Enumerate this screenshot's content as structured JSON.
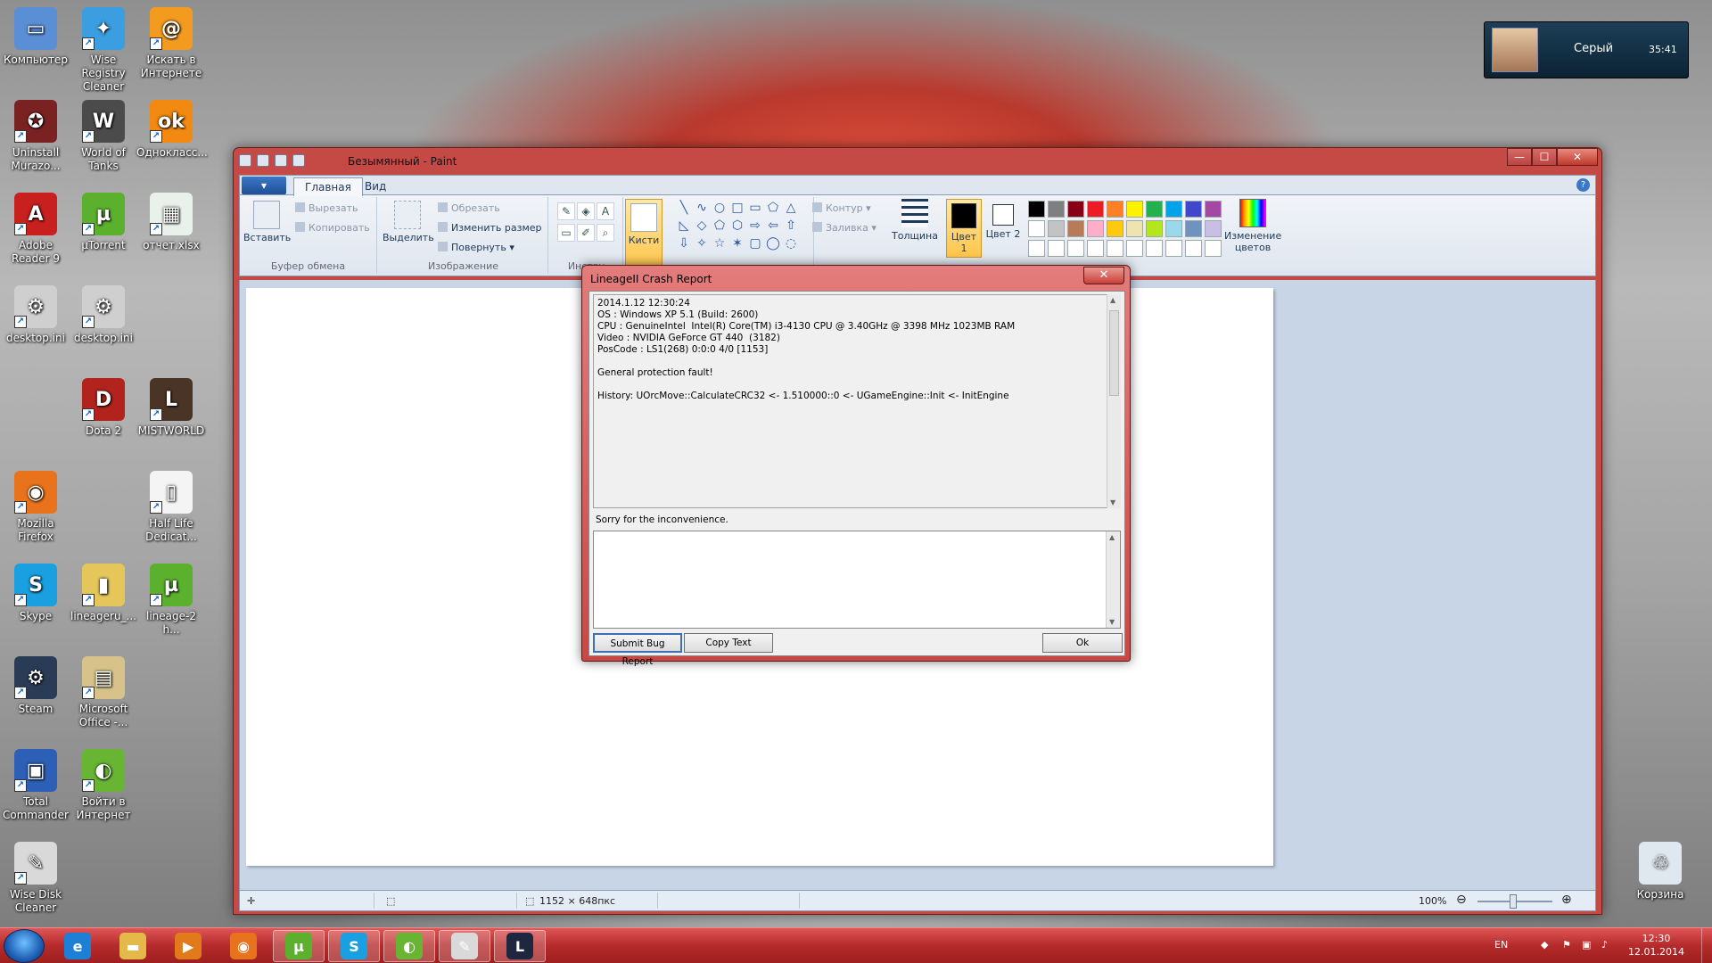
{
  "desktop_icons": [
    {
      "name": "computer",
      "label": "Компьютер",
      "color": "#5a8fd6",
      "glyph": "▭"
    },
    {
      "name": "wise-registry",
      "label": "Wise Registry Cleaner",
      "color": "#3a9ee0",
      "glyph": "✦"
    },
    {
      "name": "search-internet",
      "label": "Искать в Интернете",
      "color": "#f29b1f",
      "glyph": "@"
    },
    {
      "name": "uninstall",
      "label": "Uninstall Murazo...",
      "color": "#7a2222",
      "glyph": "✪"
    },
    {
      "name": "world-of-tanks",
      "label": "World of Tanks",
      "color": "#4b4b4b",
      "glyph": "W"
    },
    {
      "name": "odnoklassniki",
      "label": "Однокласс...",
      "color": "#f28a12",
      "glyph": "ok"
    },
    {
      "name": "adobe-reader",
      "label": "Adobe Reader 9",
      "color": "#c81f1f",
      "glyph": "A"
    },
    {
      "name": "utorrent",
      "label": "µTorrent",
      "color": "#5bb12d",
      "glyph": "µ"
    },
    {
      "name": "otchet",
      "label": "отчет.xlsx",
      "color": "#e9f1ea",
      "glyph": "▦"
    },
    {
      "name": "desktop-ini-1",
      "label": "desktop.ini",
      "color": "#cfcfcf",
      "glyph": "⚙"
    },
    {
      "name": "desktop-ini-2",
      "label": "desktop.ini",
      "color": "#cfcfcf",
      "glyph": "⚙"
    },
    {
      "name": "dota2",
      "label": "Dota 2",
      "color": "#b3231e",
      "glyph": "D"
    },
    {
      "name": "mistworld",
      "label": "MISTWORLD",
      "color": "#4a3426",
      "glyph": "L"
    },
    {
      "name": "firefox",
      "label": "Mozilla Firefox",
      "color": "#e8731c",
      "glyph": "◉"
    },
    {
      "name": "half-life",
      "label": "Half Life Dedicat...",
      "color": "#f4f4f4",
      "glyph": "▯"
    },
    {
      "name": "skype",
      "label": "Skype",
      "color": "#1a9fe0",
      "glyph": "S"
    },
    {
      "name": "lineageru",
      "label": "lineageru_...",
      "color": "#e5c65a",
      "glyph": "▮"
    },
    {
      "name": "lineage2-utorrent",
      "label": "lineage-2 h...",
      "color": "#5bb12d",
      "glyph": "µ"
    },
    {
      "name": "steam",
      "label": "Steam",
      "color": "#2a3c55",
      "glyph": "⚙"
    },
    {
      "name": "ms-office",
      "label": "Microsoft Office -...",
      "color": "#d7c38a",
      "glyph": "▤"
    },
    {
      "name": "total-commander",
      "label": "Total Commander",
      "color": "#2c5fb5",
      "glyph": "▣"
    },
    {
      "name": "vojti-internet",
      "label": "Войти в Интернет",
      "color": "#68b534",
      "glyph": "◐"
    },
    {
      "name": "wise-disk",
      "label": "Wise Disk Cleaner",
      "color": "#d9d9d9",
      "glyph": "✎"
    },
    {
      "name": "recycle-bin",
      "label": "Корзина",
      "color": "#dfe7ef",
      "glyph": "♲"
    }
  ],
  "user_widget": {
    "name": "Серый",
    "time": "35:41"
  },
  "paint": {
    "title": "Безымянный - Paint",
    "tabs": [
      "Главная",
      "Вид"
    ],
    "file_tab": "▾",
    "clipboard": {
      "paste": "Вставить",
      "cut": "Вырезать",
      "copy": "Копировать",
      "group": "Буфер обмена"
    },
    "image": {
      "select": "Выделить",
      "crop": "Обрезать",
      "resize": "Изменить размер",
      "rotate": "Повернуть ▾",
      "group": "Изображение"
    },
    "tools": {
      "group": "Инстру"
    },
    "brushes": "Кисти",
    "shapes": {
      "outline": "Контур ▾",
      "fill": "Заливка ▾"
    },
    "thickness": "Толщина",
    "color1": "Цвет 1",
    "color2": "Цвет 2",
    "edit_colors": "Изменение цветов",
    "palette_row1": [
      "#000000",
      "#7f7f7f",
      "#880015",
      "#ed1c24",
      "#ff7f27",
      "#fff200",
      "#22b14c",
      "#00a2e8",
      "#3f48cc",
      "#a349a4"
    ],
    "palette_row2": [
      "#ffffff",
      "#c3c3c3",
      "#b97a57",
      "#ffaec9",
      "#ffc90e",
      "#efe4b0",
      "#b5e61d",
      "#99d9ea",
      "#7092be",
      "#c8bfe7"
    ],
    "status": {
      "canvas_size": "1152 × 648пкс",
      "zoom": "100%"
    }
  },
  "crash": {
    "title": "LineageII Crash Report",
    "log": "2014.1.12 12:30:24\nOS : Windows XP 5.1 (Build: 2600)\nCPU : GenuineIntel  Intel(R) Core(TM) i3-4130 CPU @ 3.40GHz @ 3398 MHz 1023MB RAM\nVideo : NVIDIA GeForce GT 440  (3182)\nPosCode : LS1(268) 0:0:0 4/0 [1153]\n\nGeneral protection fault!\n\nHistory: UOrcMove::CalculateCRC32 <- 1.510000::0 <- UGameEngine::Init <- InitEngine",
    "sorry": "Sorry for the inconvenience.",
    "submit": "Submit Bug Report",
    "copy": "Copy Text",
    "ok": "Ok"
  },
  "taskbar": {
    "apps": [
      {
        "name": "ie",
        "color": "#1e7fd6",
        "glyph": "e",
        "active": false
      },
      {
        "name": "explorer",
        "color": "#e5b84a",
        "glyph": "▬",
        "active": false
      },
      {
        "name": "media-player",
        "color": "#e07a1a",
        "glyph": "▶",
        "active": false
      },
      {
        "name": "firefox",
        "color": "#e8731c",
        "glyph": "◉",
        "active": false
      },
      {
        "name": "utorrent",
        "color": "#5bb12d",
        "glyph": "µ",
        "active": true
      },
      {
        "name": "skype",
        "color": "#1a9fe0",
        "glyph": "S",
        "active": true
      },
      {
        "name": "internet",
        "color": "#68b534",
        "glyph": "◐",
        "active": true
      },
      {
        "name": "paint",
        "color": "#d9d9d9",
        "glyph": "✎",
        "active": true
      },
      {
        "name": "lineage",
        "color": "#1f2640",
        "glyph": "L",
        "active": true
      }
    ],
    "lang": "EN",
    "time": "12:30",
    "date": "12.01.2014"
  }
}
